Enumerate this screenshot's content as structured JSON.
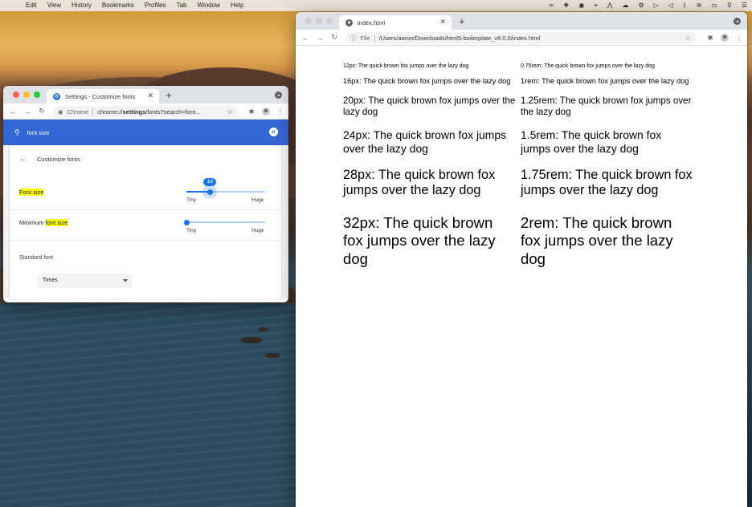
{
  "menubar": {
    "items": [
      "Edit",
      "View",
      "History",
      "Bookmarks",
      "Profiles",
      "Tab",
      "Window",
      "Help"
    ],
    "status_icons": [
      "creative-cloud-icon",
      "dropbox-icon",
      "record-icon",
      "crosshair-icon",
      "app-icon",
      "cloud-icon",
      "gear-icon",
      "play-icon",
      "volume-icon",
      "bluetooth-icon",
      "wifi-icon",
      "battery-icon",
      "search-icon",
      "control-center-icon"
    ]
  },
  "settings_window": {
    "tab_title": "Settings - Customize fonts",
    "omnibox_scheme": "Chrome",
    "omnibox_url_host": "chrome://",
    "omnibox_url_bold": "settings",
    "omnibox_url_rest": "/fonts?search=font...",
    "search_query": "font size",
    "section_title": "Customize fonts",
    "font_size_label": "Font size",
    "font_size_value": "16",
    "font_size_level": 0.3,
    "min_font_prefix": "Minimum ",
    "min_font_highlight": "font size",
    "min_font_level": 0.0,
    "tick_tiny": "Tiny",
    "tick_huge": "Huge",
    "standard_font_label": "Standard font",
    "standard_font_value": "Times"
  },
  "page_window": {
    "tab_title": "index.html",
    "omnibox_scheme": "File",
    "omnibox_url": "/Users/aaron/Downloads/html5-boilerplate_v8.0.0/index.html",
    "lines_px": [
      {
        "text": "12px: The quick brown fox jumps over the lazy dog",
        "size": 12
      },
      {
        "text": "16px: The quick brown fox jumps over the lazy dog",
        "size": 16
      },
      {
        "text": "20px: The quick brown fox jumps over the lazy dog",
        "size": 20
      },
      {
        "text": "24px: The quick brown fox jumps over the lazy dog",
        "size": 24
      },
      {
        "text": "28px: The quick brown fox jumps over the lazy dog",
        "size": 28
      },
      {
        "text": "32px: The quick brown fox jumps over the lazy dog",
        "size": 32
      }
    ],
    "lines_rem": [
      {
        "text": "0.75rem: The quick brown fox jumps over the lazy dog",
        "size": 12
      },
      {
        "text": "1rem: The quick brown fox jumps over the lazy dog",
        "size": 16
      },
      {
        "text": "1.25rem: The quick brown fox jumps over the lazy dog",
        "size": 20
      },
      {
        "text": "1.5rem: The quick brown fox jumps over the lazy dog",
        "size": 24
      },
      {
        "text": "1.75rem: The quick brown fox jumps over the lazy dog",
        "size": 28
      },
      {
        "text": "2rem: The quick brown fox jumps over the lazy dog",
        "size": 32
      }
    ]
  },
  "colors": {
    "accent": "#1a73e8",
    "search_bar": "#3367d6",
    "highlight": "#ffff00"
  }
}
